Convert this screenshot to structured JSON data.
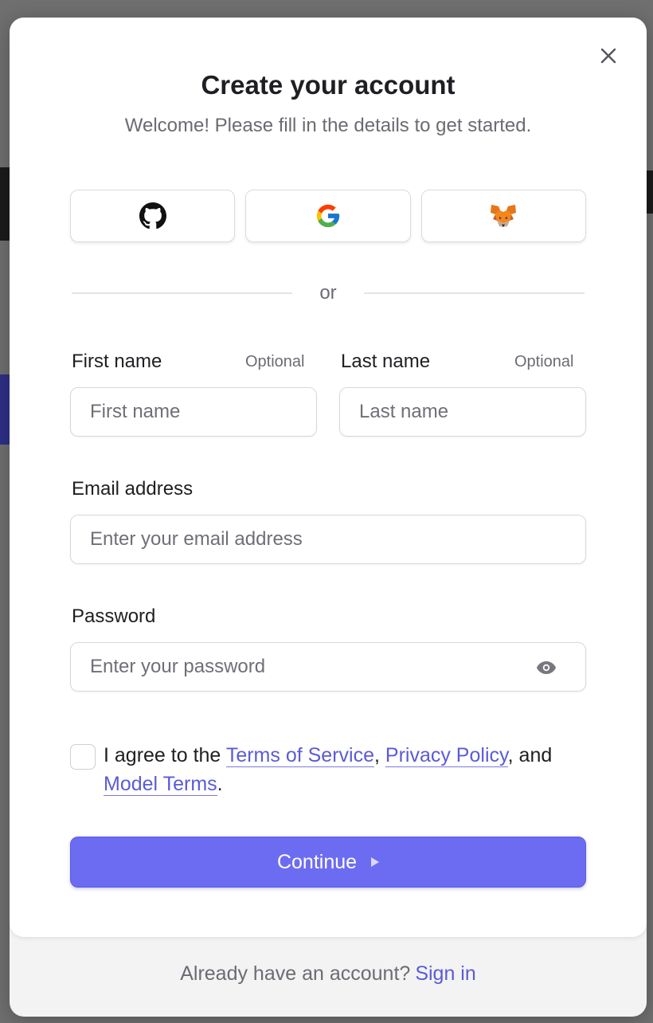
{
  "header": {
    "title": "Create your account",
    "subtitle": "Welcome! Please fill in the details to get started."
  },
  "social": [
    {
      "name": "GitHub",
      "icon": "github-icon"
    },
    {
      "name": "Google",
      "icon": "google-icon"
    },
    {
      "name": "MetaMask",
      "icon": "metamask-fox-icon"
    }
  ],
  "divider": {
    "label": "or"
  },
  "form": {
    "first_name": {
      "label": "First name",
      "optional": "Optional",
      "placeholder": "First name",
      "value": ""
    },
    "last_name": {
      "label": "Last name",
      "optional": "Optional",
      "placeholder": "Last name",
      "value": ""
    },
    "email": {
      "label": "Email address",
      "placeholder": "Enter your email address",
      "value": ""
    },
    "password": {
      "label": "Password",
      "placeholder": "Enter your password",
      "value": "",
      "toggle_icon": "eye-icon"
    }
  },
  "consent": {
    "checked": false,
    "prefix": "I agree to the ",
    "terms": "Terms of Service",
    "sep1": ", ",
    "privacy": "Privacy Policy",
    "sep2": ", and ",
    "model_terms": "Model Terms",
    "suffix": "."
  },
  "continue": {
    "label": "Continue",
    "icon": "play-triangle-icon"
  },
  "footer": {
    "text": "Already have an account?",
    "link": "Sign in"
  },
  "colors": {
    "accent": "#6c6cf2",
    "link": "#5b5bd6",
    "overlay": "#6f6f6f"
  }
}
